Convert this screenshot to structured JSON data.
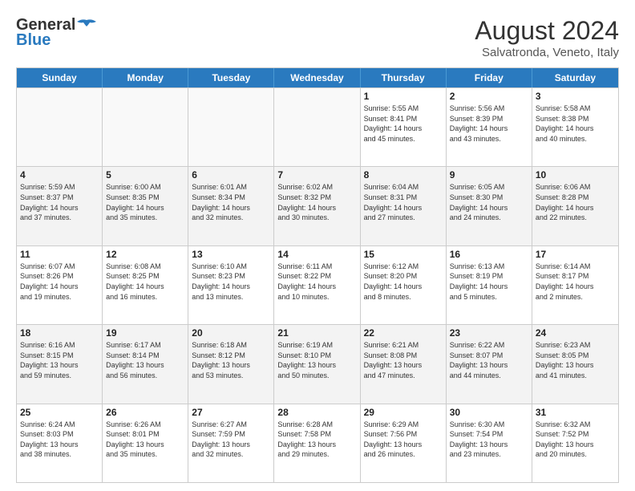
{
  "header": {
    "logo_line1": "General",
    "logo_line2": "Blue",
    "main_title": "August 2024",
    "subtitle": "Salvatronda, Veneto, Italy"
  },
  "days_of_week": [
    "Sunday",
    "Monday",
    "Tuesday",
    "Wednesday",
    "Thursday",
    "Friday",
    "Saturday"
  ],
  "weeks": [
    [
      {
        "day": "",
        "info": ""
      },
      {
        "day": "",
        "info": ""
      },
      {
        "day": "",
        "info": ""
      },
      {
        "day": "",
        "info": ""
      },
      {
        "day": "1",
        "info": "Sunrise: 5:55 AM\nSunset: 8:41 PM\nDaylight: 14 hours\nand 45 minutes."
      },
      {
        "day": "2",
        "info": "Sunrise: 5:56 AM\nSunset: 8:39 PM\nDaylight: 14 hours\nand 43 minutes."
      },
      {
        "day": "3",
        "info": "Sunrise: 5:58 AM\nSunset: 8:38 PM\nDaylight: 14 hours\nand 40 minutes."
      }
    ],
    [
      {
        "day": "4",
        "info": "Sunrise: 5:59 AM\nSunset: 8:37 PM\nDaylight: 14 hours\nand 37 minutes."
      },
      {
        "day": "5",
        "info": "Sunrise: 6:00 AM\nSunset: 8:35 PM\nDaylight: 14 hours\nand 35 minutes."
      },
      {
        "day": "6",
        "info": "Sunrise: 6:01 AM\nSunset: 8:34 PM\nDaylight: 14 hours\nand 32 minutes."
      },
      {
        "day": "7",
        "info": "Sunrise: 6:02 AM\nSunset: 8:32 PM\nDaylight: 14 hours\nand 30 minutes."
      },
      {
        "day": "8",
        "info": "Sunrise: 6:04 AM\nSunset: 8:31 PM\nDaylight: 14 hours\nand 27 minutes."
      },
      {
        "day": "9",
        "info": "Sunrise: 6:05 AM\nSunset: 8:30 PM\nDaylight: 14 hours\nand 24 minutes."
      },
      {
        "day": "10",
        "info": "Sunrise: 6:06 AM\nSunset: 8:28 PM\nDaylight: 14 hours\nand 22 minutes."
      }
    ],
    [
      {
        "day": "11",
        "info": "Sunrise: 6:07 AM\nSunset: 8:26 PM\nDaylight: 14 hours\nand 19 minutes."
      },
      {
        "day": "12",
        "info": "Sunrise: 6:08 AM\nSunset: 8:25 PM\nDaylight: 14 hours\nand 16 minutes."
      },
      {
        "day": "13",
        "info": "Sunrise: 6:10 AM\nSunset: 8:23 PM\nDaylight: 14 hours\nand 13 minutes."
      },
      {
        "day": "14",
        "info": "Sunrise: 6:11 AM\nSunset: 8:22 PM\nDaylight: 14 hours\nand 10 minutes."
      },
      {
        "day": "15",
        "info": "Sunrise: 6:12 AM\nSunset: 8:20 PM\nDaylight: 14 hours\nand 8 minutes."
      },
      {
        "day": "16",
        "info": "Sunrise: 6:13 AM\nSunset: 8:19 PM\nDaylight: 14 hours\nand 5 minutes."
      },
      {
        "day": "17",
        "info": "Sunrise: 6:14 AM\nSunset: 8:17 PM\nDaylight: 14 hours\nand 2 minutes."
      }
    ],
    [
      {
        "day": "18",
        "info": "Sunrise: 6:16 AM\nSunset: 8:15 PM\nDaylight: 13 hours\nand 59 minutes."
      },
      {
        "day": "19",
        "info": "Sunrise: 6:17 AM\nSunset: 8:14 PM\nDaylight: 13 hours\nand 56 minutes."
      },
      {
        "day": "20",
        "info": "Sunrise: 6:18 AM\nSunset: 8:12 PM\nDaylight: 13 hours\nand 53 minutes."
      },
      {
        "day": "21",
        "info": "Sunrise: 6:19 AM\nSunset: 8:10 PM\nDaylight: 13 hours\nand 50 minutes."
      },
      {
        "day": "22",
        "info": "Sunrise: 6:21 AM\nSunset: 8:08 PM\nDaylight: 13 hours\nand 47 minutes."
      },
      {
        "day": "23",
        "info": "Sunrise: 6:22 AM\nSunset: 8:07 PM\nDaylight: 13 hours\nand 44 minutes."
      },
      {
        "day": "24",
        "info": "Sunrise: 6:23 AM\nSunset: 8:05 PM\nDaylight: 13 hours\nand 41 minutes."
      }
    ],
    [
      {
        "day": "25",
        "info": "Sunrise: 6:24 AM\nSunset: 8:03 PM\nDaylight: 13 hours\nand 38 minutes."
      },
      {
        "day": "26",
        "info": "Sunrise: 6:26 AM\nSunset: 8:01 PM\nDaylight: 13 hours\nand 35 minutes."
      },
      {
        "day": "27",
        "info": "Sunrise: 6:27 AM\nSunset: 7:59 PM\nDaylight: 13 hours\nand 32 minutes."
      },
      {
        "day": "28",
        "info": "Sunrise: 6:28 AM\nSunset: 7:58 PM\nDaylight: 13 hours\nand 29 minutes."
      },
      {
        "day": "29",
        "info": "Sunrise: 6:29 AM\nSunset: 7:56 PM\nDaylight: 13 hours\nand 26 minutes."
      },
      {
        "day": "30",
        "info": "Sunrise: 6:30 AM\nSunset: 7:54 PM\nDaylight: 13 hours\nand 23 minutes."
      },
      {
        "day": "31",
        "info": "Sunrise: 6:32 AM\nSunset: 7:52 PM\nDaylight: 13 hours\nand 20 minutes."
      }
    ]
  ]
}
